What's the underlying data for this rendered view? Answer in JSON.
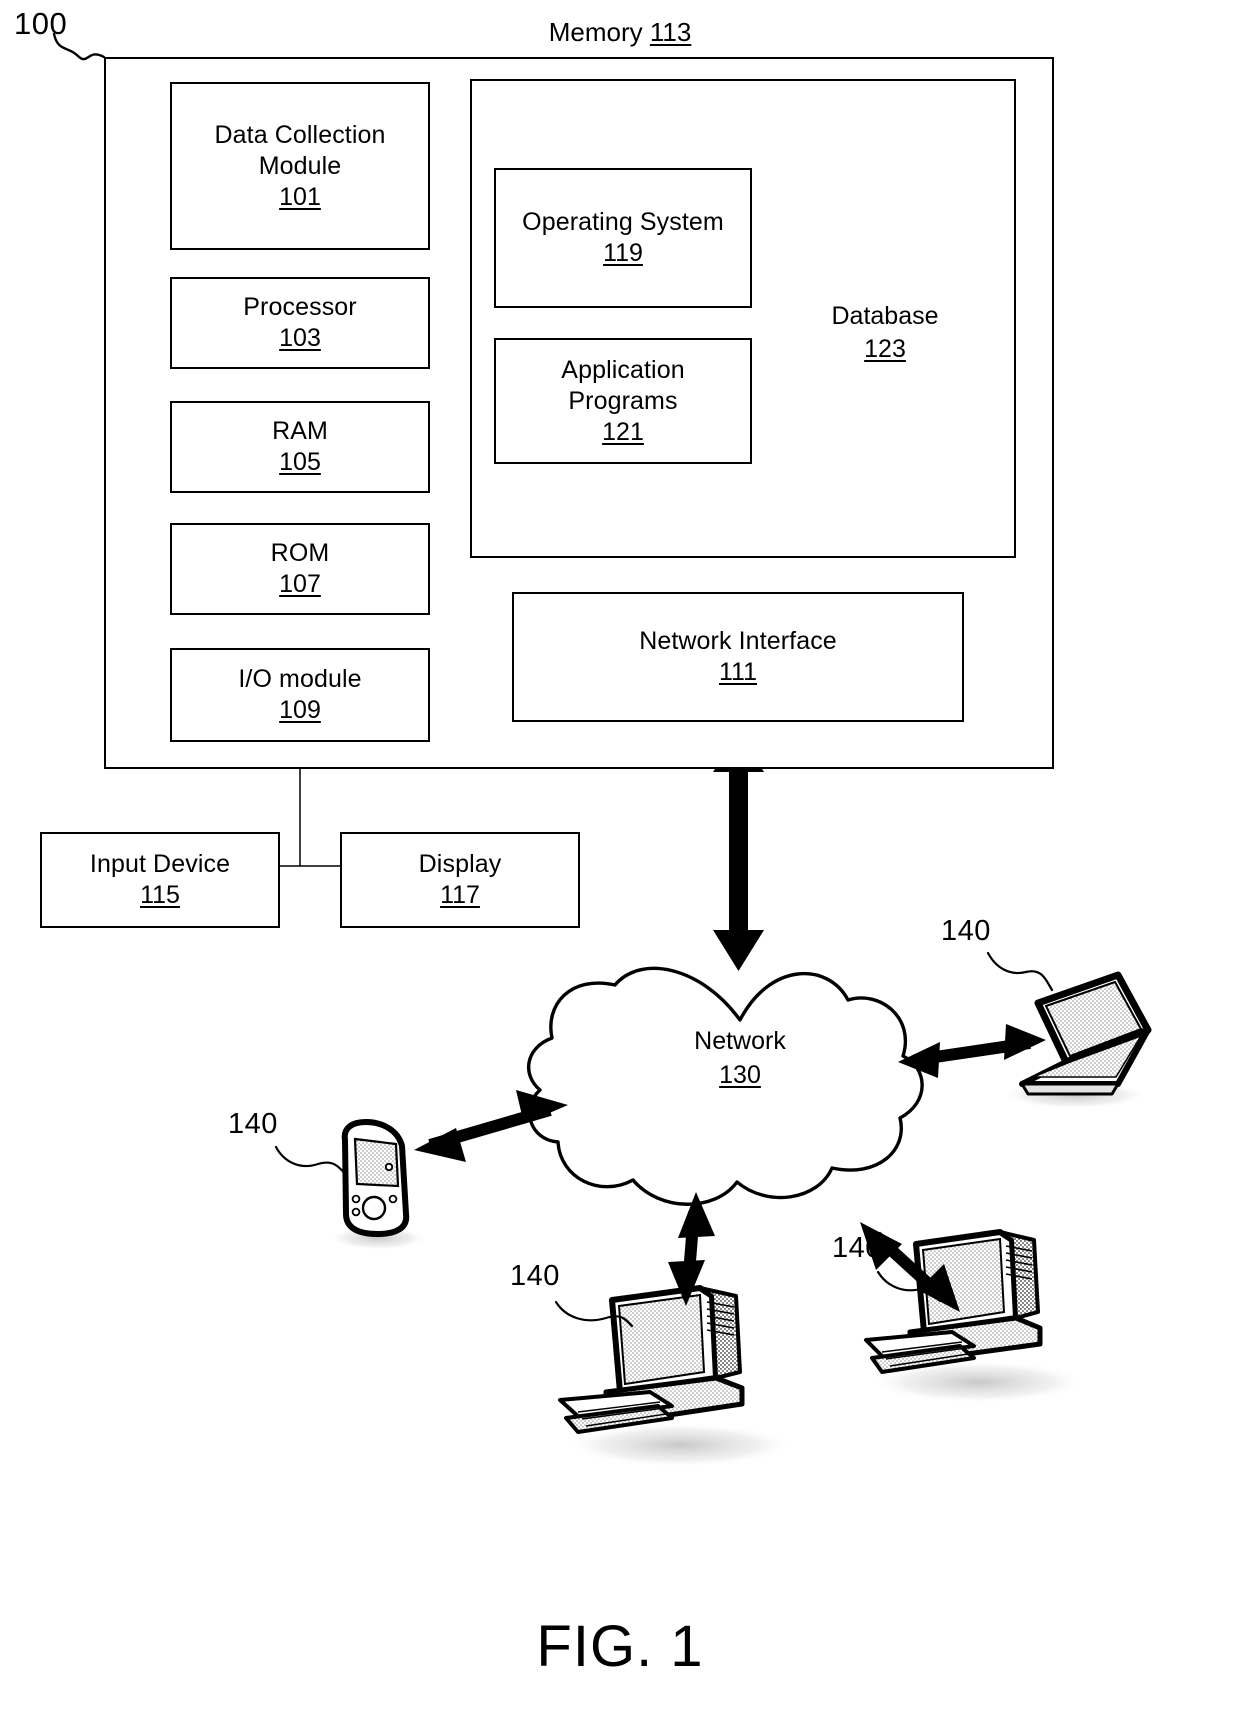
{
  "figure": {
    "caption": "FIG. 1",
    "system_ref": "100"
  },
  "system": {
    "left_column": [
      {
        "label": "Data Collection\nModule",
        "num": "101"
      },
      {
        "label": "Processor",
        "num": "103"
      },
      {
        "label": "RAM",
        "num": "105"
      },
      {
        "label": "ROM",
        "num": "107"
      },
      {
        "label": "I/O module",
        "num": "109"
      }
    ],
    "memory": {
      "title": "Memory",
      "num": "113",
      "items": [
        {
          "label": "Operating System",
          "num": "119"
        },
        {
          "label": "Application\nPrograms",
          "num": "121"
        }
      ],
      "database": {
        "label": "Database",
        "num": "123"
      }
    },
    "network_interface": {
      "label": "Network Interface",
      "num": "111"
    }
  },
  "peripherals": [
    {
      "label": "Input Device",
      "num": "115"
    },
    {
      "label": "Display",
      "num": "117"
    }
  ],
  "network": {
    "label": "Network",
    "num": "130"
  },
  "clients": [
    {
      "device": "laptop",
      "ref": "140"
    },
    {
      "device": "mobile-phone",
      "ref": "140"
    },
    {
      "device": "desktop-center",
      "ref": "140"
    },
    {
      "device": "desktop-right",
      "ref": "140"
    }
  ],
  "colors": {
    "line": "#000000",
    "background": "#ffffff",
    "device_fill": "#d9d9d9",
    "device_shade": "#bdbdbd"
  }
}
